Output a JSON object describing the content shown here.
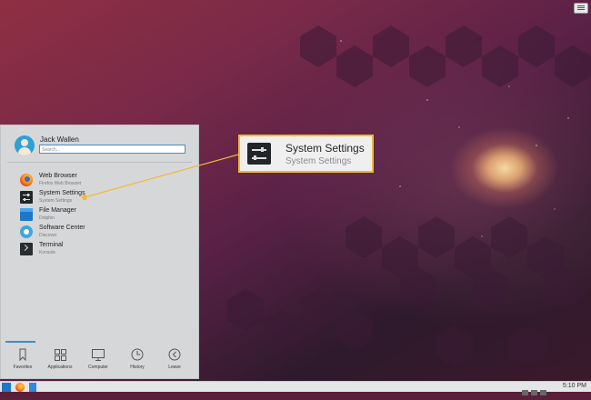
{
  "menu": {
    "user_name": "Jack Wallen",
    "search_placeholder": "Search...",
    "apps": [
      {
        "name": "Web Browser",
        "sub": "Firefox Web Browser",
        "icon": "firefox-icon"
      },
      {
        "name": "System Settings",
        "sub": "System Settings",
        "icon": "settings-icon"
      },
      {
        "name": "File Manager",
        "sub": "Dolphin",
        "icon": "folder-icon"
      },
      {
        "name": "Software Center",
        "sub": "Discover",
        "icon": "discover-icon"
      },
      {
        "name": "Terminal",
        "sub": "Konsole",
        "icon": "terminal-icon"
      }
    ],
    "tabs": [
      {
        "label": "Favorites",
        "icon": "bookmark-icon"
      },
      {
        "label": "Applications",
        "icon": "grid-icon"
      },
      {
        "label": "Computer",
        "icon": "monitor-icon"
      },
      {
        "label": "History",
        "icon": "clock-icon"
      },
      {
        "label": "Leave",
        "icon": "back-arrow-icon"
      }
    ],
    "active_tab": "Favorites"
  },
  "callout": {
    "title": "System Settings",
    "subtitle": "System Settings",
    "border_color": "#f2b936"
  },
  "taskbar": {
    "clock": "5:10 PM"
  },
  "colors": {
    "accent": "#3d8fd6"
  }
}
